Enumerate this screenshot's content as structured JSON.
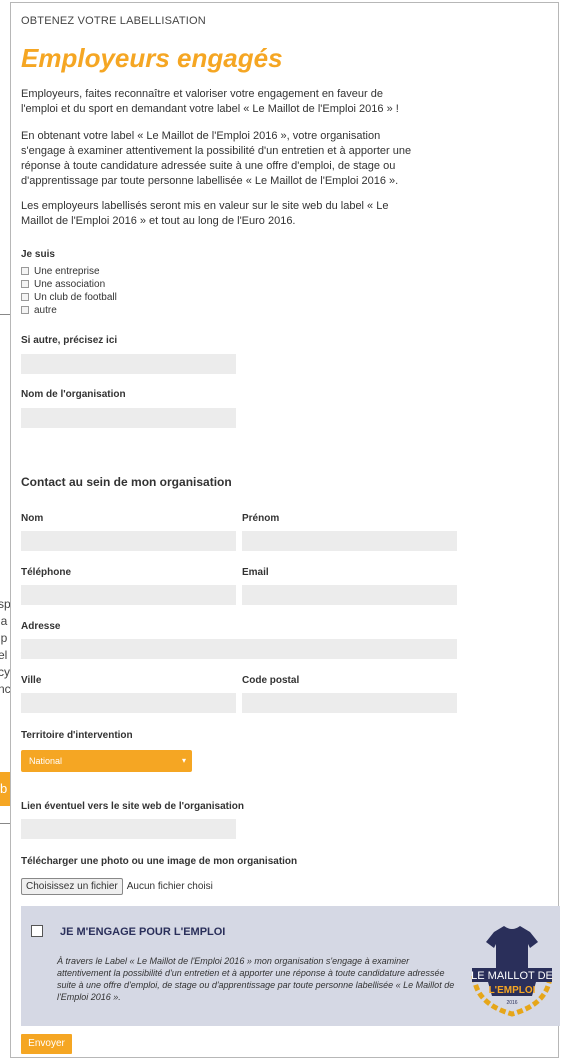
{
  "background_fragments": [
    "sp",
    "la",
    "ip",
    "el",
    "cy",
    "nc"
  ],
  "background_button_fragment": "b",
  "form": {
    "eyebrow": "OBTENEZ VOTRE LABELLISATION",
    "title": "Employeurs engagés",
    "intro_1": "Employeurs, faites reconnaître et valoriser votre engagement en faveur de l'emploi et du sport en demandant votre label « Le Maillot de l'Emploi 2016 » !",
    "intro_2": "En obtenant votre label « Le Maillot de l'Emploi 2016 », votre organisation s'engage à examiner attentivement la possibilité d'un entretien et à apporter une réponse à toute candidature adressée suite à une offre d'emploi, de stage ou d'apprentissage par toute personne labellisée « Le Maillot de l'Emploi 2016 ».",
    "intro_3": "Les employeurs labellisés seront mis en valeur sur le site web du label « Le Maillot de l'Emploi 2016 » et tout au long de l'Euro 2016.",
    "je_suis_label": "Je suis",
    "je_suis_options": [
      "Une entreprise",
      "Une association",
      "Un club de football",
      "autre"
    ],
    "si_autre_label": "Si autre, précisez ici",
    "nom_org_label": "Nom de l'organisation",
    "contact_title": "Contact au sein de mon organisation",
    "nom_label": "Nom",
    "prenom_label": "Prénom",
    "telephone_label": "Téléphone",
    "email_label": "Email",
    "adresse_label": "Adresse",
    "ville_label": "Ville",
    "code_postal_label": "Code postal",
    "territoire_label": "Territoire d'intervention",
    "territoire_value": "National",
    "lien_label": "Lien éventuel vers le site web de l'organisation",
    "telecharger_label": "Télécharger une photo ou une image de mon organisation",
    "file_button": "Choisissez un fichier",
    "file_status": "Aucun fichier choisi",
    "engage_title": "JE M'ENGAGE POUR L'EMPLOI",
    "engage_text": "À travers le Label « Le Maillot de l'Emploi 2016 » mon organisation s'engage à examiner attentivement la possibilité d'un entretien et à apporter une réponse à toute candidature adressée suite à une offre d'emploi, de stage ou d'apprentissage par toute personne labellisée « Le Maillot de l'Emploi 2016 ».",
    "logo": {
      "line1": "LE MAILLOT DE",
      "line2": "L'EMPLOI",
      "year": "2016"
    },
    "submit": "Envoyer"
  },
  "colors": {
    "accent": "#f5a623",
    "navy": "#2a2f5a",
    "field": "#ececec",
    "engage_bg": "#d5d8e4"
  }
}
